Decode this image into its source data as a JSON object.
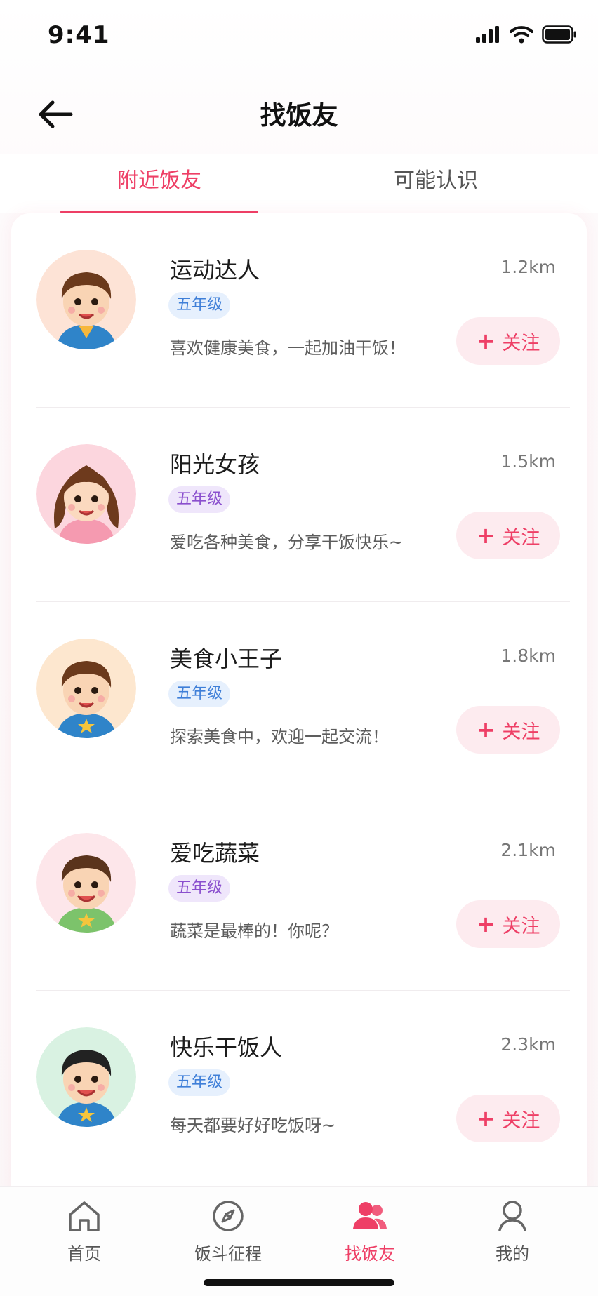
{
  "status": {
    "time": "9:41"
  },
  "header": {
    "title": "找饭友",
    "back_icon": "arrow-left-icon"
  },
  "tabs": [
    {
      "label": "附近饭友",
      "active": true
    },
    {
      "label": "可能认识",
      "active": false
    }
  ],
  "friends": [
    {
      "name": "运动达人",
      "distance": "1.2km",
      "grade": "五年级",
      "grade_color": "blue",
      "bio": "喜欢健康美食，一起加油干饭！",
      "follow_label": "关注",
      "avatar_bg": "#fde3d6",
      "hair": "#6b3a1c",
      "shirt": "#2f84c9",
      "skin": "#f9d4b4"
    },
    {
      "name": "阳光女孩",
      "distance": "1.5km",
      "grade": "五年级",
      "grade_color": "purple",
      "bio": "爱吃各种美食，分享干饭快乐~",
      "follow_label": "关注",
      "avatar_bg": "#fcd6de",
      "hair": "#6e3a1d",
      "shirt": "#f59ab0",
      "skin": "#fbd9bf"
    },
    {
      "name": "美食小王子",
      "distance": "1.8km",
      "grade": "五年级",
      "grade_color": "blue",
      "bio": "探索美食中，欢迎一起交流！",
      "follow_label": "关注",
      "avatar_bg": "#fde7cf",
      "hair": "#6b3a1c",
      "shirt": "#2f84c9",
      "skin": "#f9d4b4"
    },
    {
      "name": "爱吃蔬菜",
      "distance": "2.1km",
      "grade": "五年级",
      "grade_color": "purple",
      "bio": "蔬菜是最棒的！你呢？",
      "follow_label": "关注",
      "avatar_bg": "#fde6ea",
      "hair": "#5a341c",
      "shirt": "#7cc36b",
      "skin": "#f9d4b4"
    },
    {
      "name": "快乐干饭人",
      "distance": "2.3km",
      "grade": "五年级",
      "grade_color": "blue",
      "bio": "每天都要好好吃饭呀~",
      "follow_label": "关注",
      "avatar_bg": "#d9f2e2",
      "hair": "#222222",
      "shirt": "#2f84c9",
      "skin": "#f9d4b4"
    }
  ],
  "nav": [
    {
      "label": "首页",
      "icon": "home-icon",
      "active": false
    },
    {
      "label": "饭斗征程",
      "icon": "compass-icon",
      "active": false
    },
    {
      "label": "找饭友",
      "icon": "friends-icon",
      "active": true
    },
    {
      "label": "我的",
      "icon": "user-icon",
      "active": false
    }
  ],
  "colors": {
    "accent": "#ee3f66",
    "grade_blue": "#3f7fd8",
    "grade_purple": "#8a4fce"
  }
}
